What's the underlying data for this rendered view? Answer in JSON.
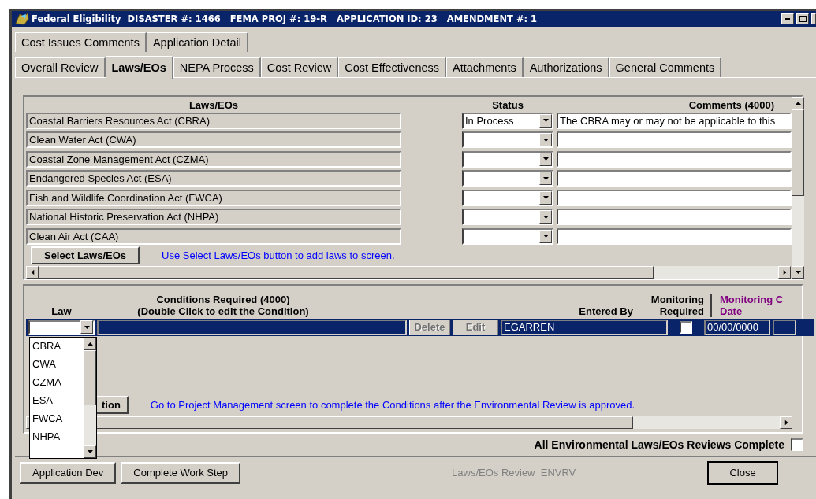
{
  "window": {
    "title": "Federal Eligibility  DISASTER #: 1466   FEMA PROJ #: 19-R   APPLICATION ID: 23   AMENDMENT #: 1"
  },
  "tabs_row_1": [
    {
      "label": "Cost Issues Comments",
      "selected": false
    },
    {
      "label": "Application Detail",
      "selected": false
    }
  ],
  "tabs_row_2": [
    {
      "label": "Overall Review",
      "selected": false
    },
    {
      "label": "Laws/EOs",
      "selected": true
    },
    {
      "label": "NEPA Process",
      "selected": false
    },
    {
      "label": "Cost Review",
      "selected": false
    },
    {
      "label": "Cost Effectiveness",
      "selected": false
    },
    {
      "label": "Attachments",
      "selected": false
    },
    {
      "label": "Authorizations",
      "selected": false
    },
    {
      "label": "General Comments",
      "selected": false
    }
  ],
  "laws_table": {
    "columns": [
      "Laws/EOs",
      "Status",
      "Comments (4000)"
    ],
    "rows": [
      {
        "law": "Coastal Barriers Resources Act (CBRA)",
        "status": "In Process",
        "comment": "The CBRA may or may not be applicable to this"
      },
      {
        "law": "Clean Water Act (CWA)"
      },
      {
        "law": "Coastal Zone Management Act (CZMA)"
      },
      {
        "law": "Endangered Species Act (ESA)"
      },
      {
        "law": "Fish and Wildlife Coordination Act (FWCA)"
      },
      {
        "law": "National Historic Preservation Act (NHPA)"
      },
      {
        "law": "Clean Air Act (CAA)"
      }
    ],
    "select_button": "Select Laws/EOs",
    "hint": "Use Select Laws/EOs button to add laws to screen."
  },
  "conditions": {
    "columns": [
      {
        "lines": [
          "Law"
        ]
      },
      {
        "lines": [
          "Conditions Required (4000)",
          "(Double Click to edit the Condition)"
        ]
      },
      {
        "lines": [
          "Entered By"
        ]
      },
      {
        "lines": [
          "Monitoring",
          "Required"
        ]
      },
      {
        "lines": [
          "Monitoring C",
          "Date"
        ],
        "color": "#800080"
      }
    ],
    "row": {
      "delete": {
        "label": "Delete",
        "disabled": true
      },
      "edit": {
        "label": "Edit",
        "disabled": true
      },
      "entered_by": "EGARREN",
      "monitoring_required": false,
      "date": "00/00/0000"
    },
    "law_dropdown": {
      "options": [
        "CBRA",
        "CWA",
        "CZMA",
        "ESA",
        "FWCA",
        "NHPA"
      ]
    },
    "button": "tion",
    "hint": "Go to Project Management screen to complete the Conditions after the Environmental Review is approved."
  },
  "all_complete": {
    "label": "All Environmental Laws/EOs Reviews Complete",
    "checked": false
  },
  "footer": {
    "buttons": [
      "Application Dev",
      "Complete Work Step"
    ],
    "status": "Laws/EOs Review  ENVRV",
    "close": "Close"
  }
}
